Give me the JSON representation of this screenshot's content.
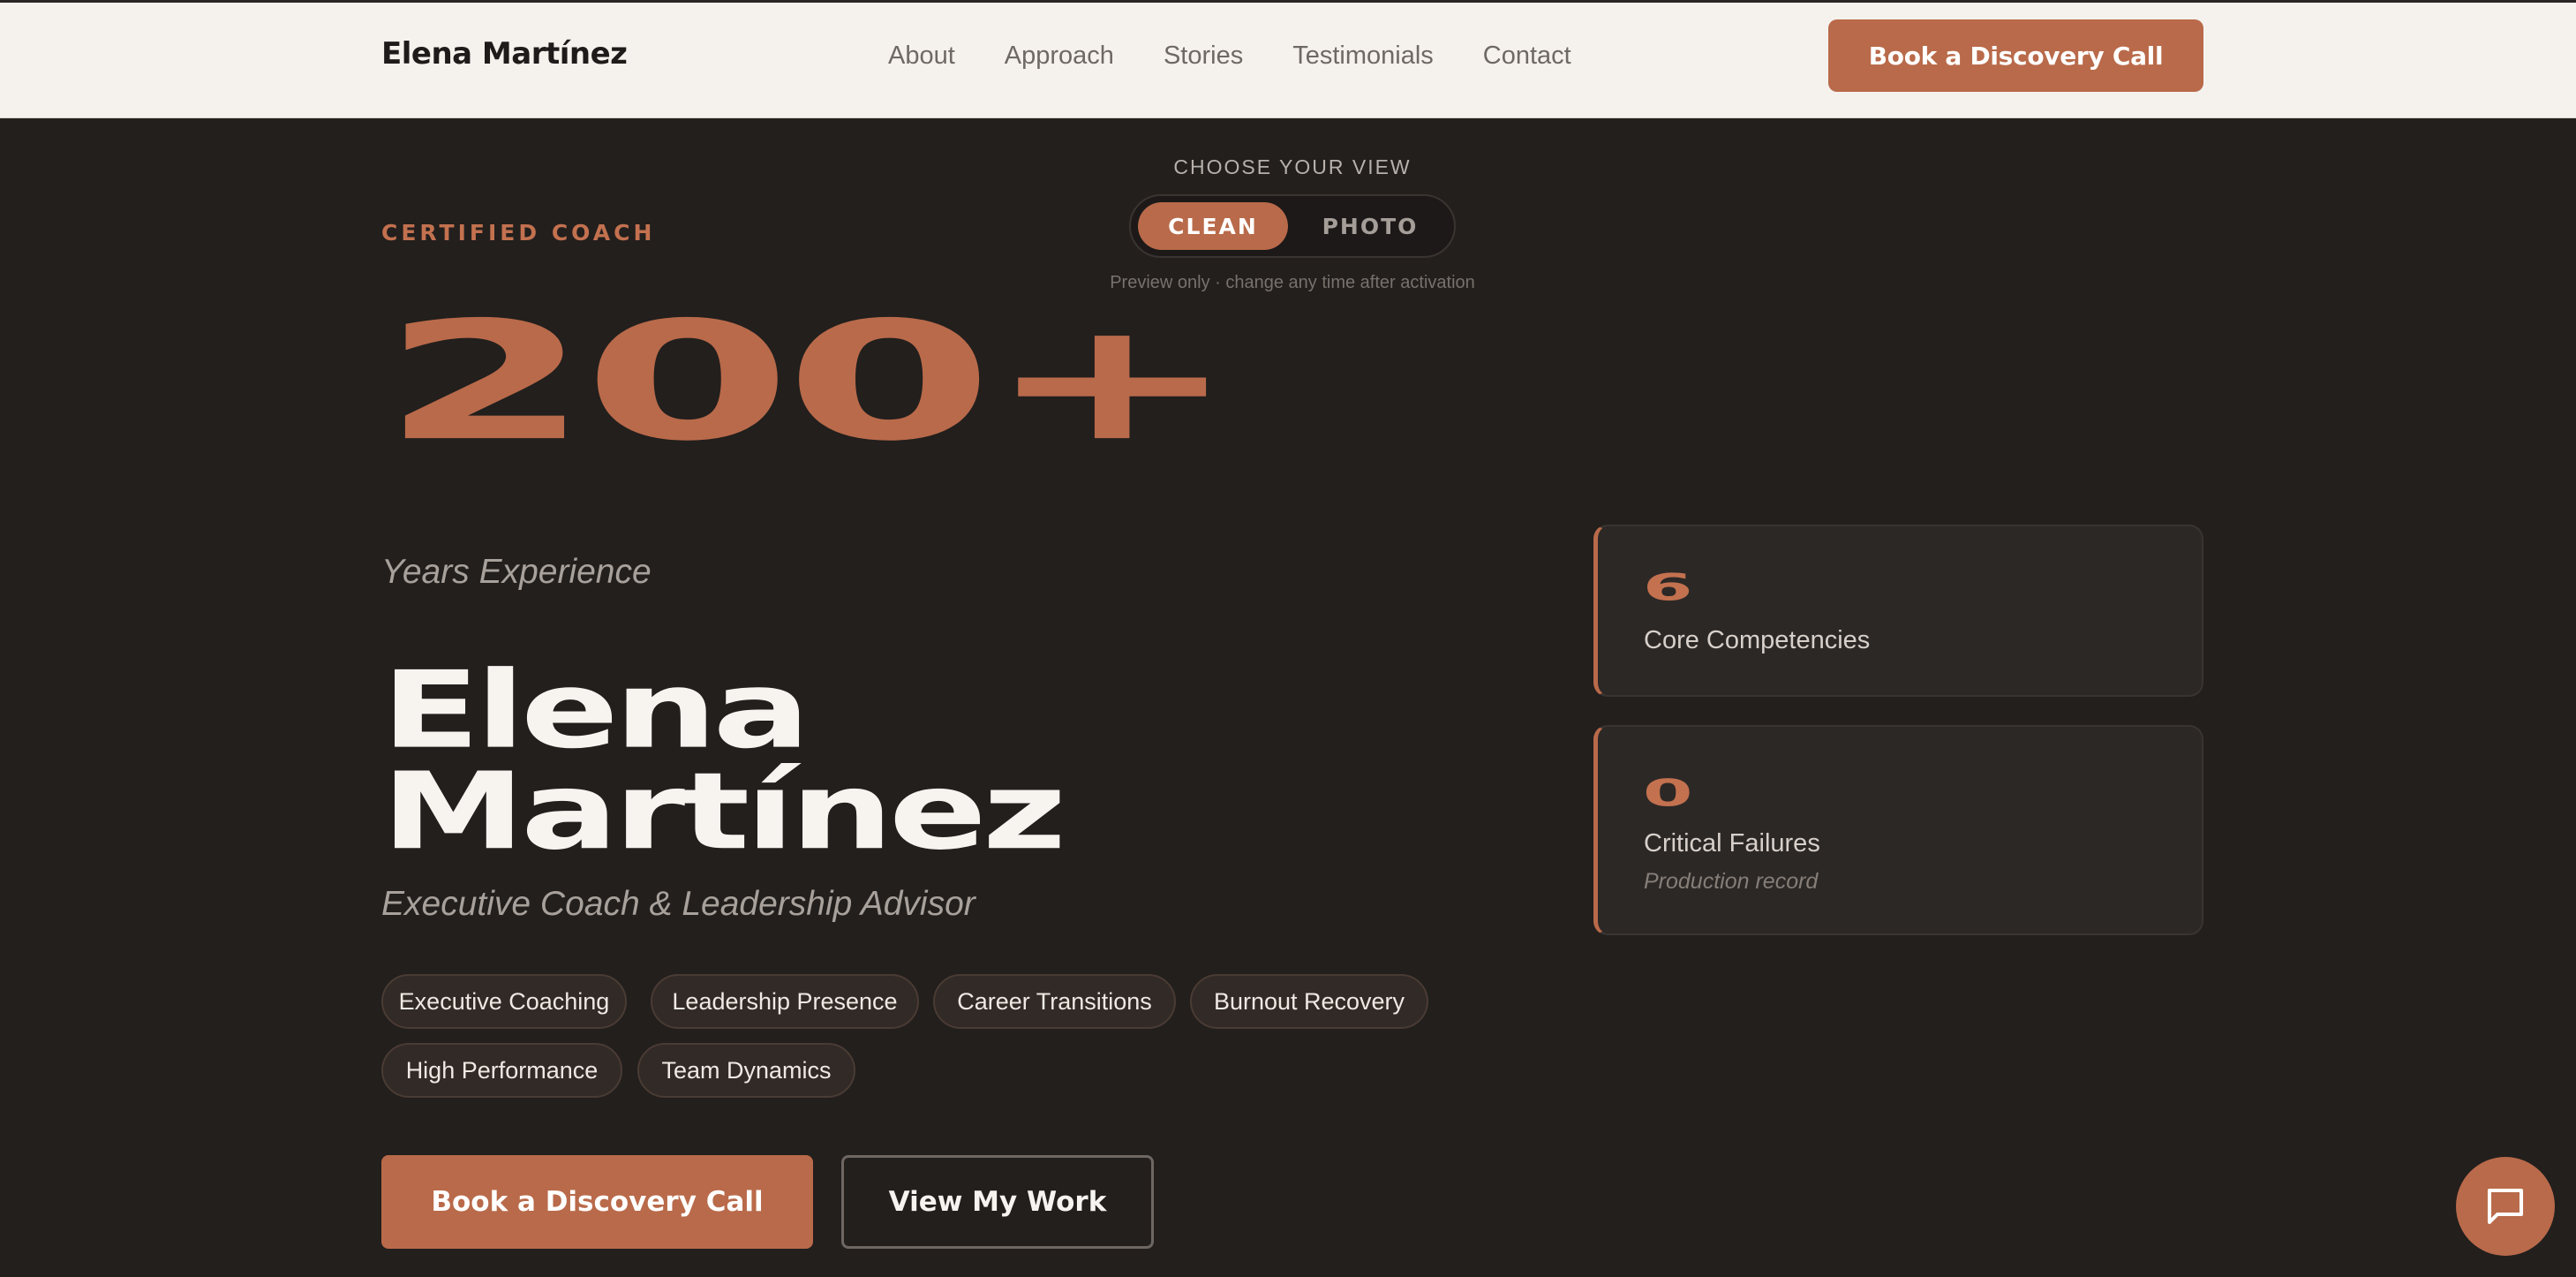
{
  "header": {
    "brand": "Elena Martínez",
    "nav": [
      "About",
      "Approach",
      "Stories",
      "Testimonials",
      "Contact"
    ],
    "cta": "Book a Discovery Call"
  },
  "view_chooser": {
    "label": "CHOOSE YOUR VIEW",
    "options": [
      "CLEAN",
      "PHOTO"
    ],
    "selected": "CLEAN",
    "note": "Preview only · change any time after activation"
  },
  "hero": {
    "eyebrow": "CERTIFIED COACH",
    "big_number": "200+",
    "big_number_caption": "Years Experience",
    "name_line1": "Elena",
    "name_line2": "Martínez",
    "role": "Executive Coach & Leadership Advisor",
    "tags": [
      "Executive Coaching",
      "Leadership Presence",
      "Career Transitions",
      "Burnout Recovery",
      "High Performance",
      "Team Dynamics"
    ],
    "primary_cta": "Book a Discovery Call",
    "secondary_cta": "View My Work"
  },
  "stats": [
    {
      "value": "6",
      "label": "Core Competencies"
    },
    {
      "value": "0",
      "label": "Critical Failures",
      "sub": "Production record"
    }
  ],
  "colors": {
    "accent": "#b96a4a",
    "background": "#221f1d",
    "header_bg": "#f5f2ee"
  },
  "icons": {
    "chat": "chat-bubble-icon"
  }
}
